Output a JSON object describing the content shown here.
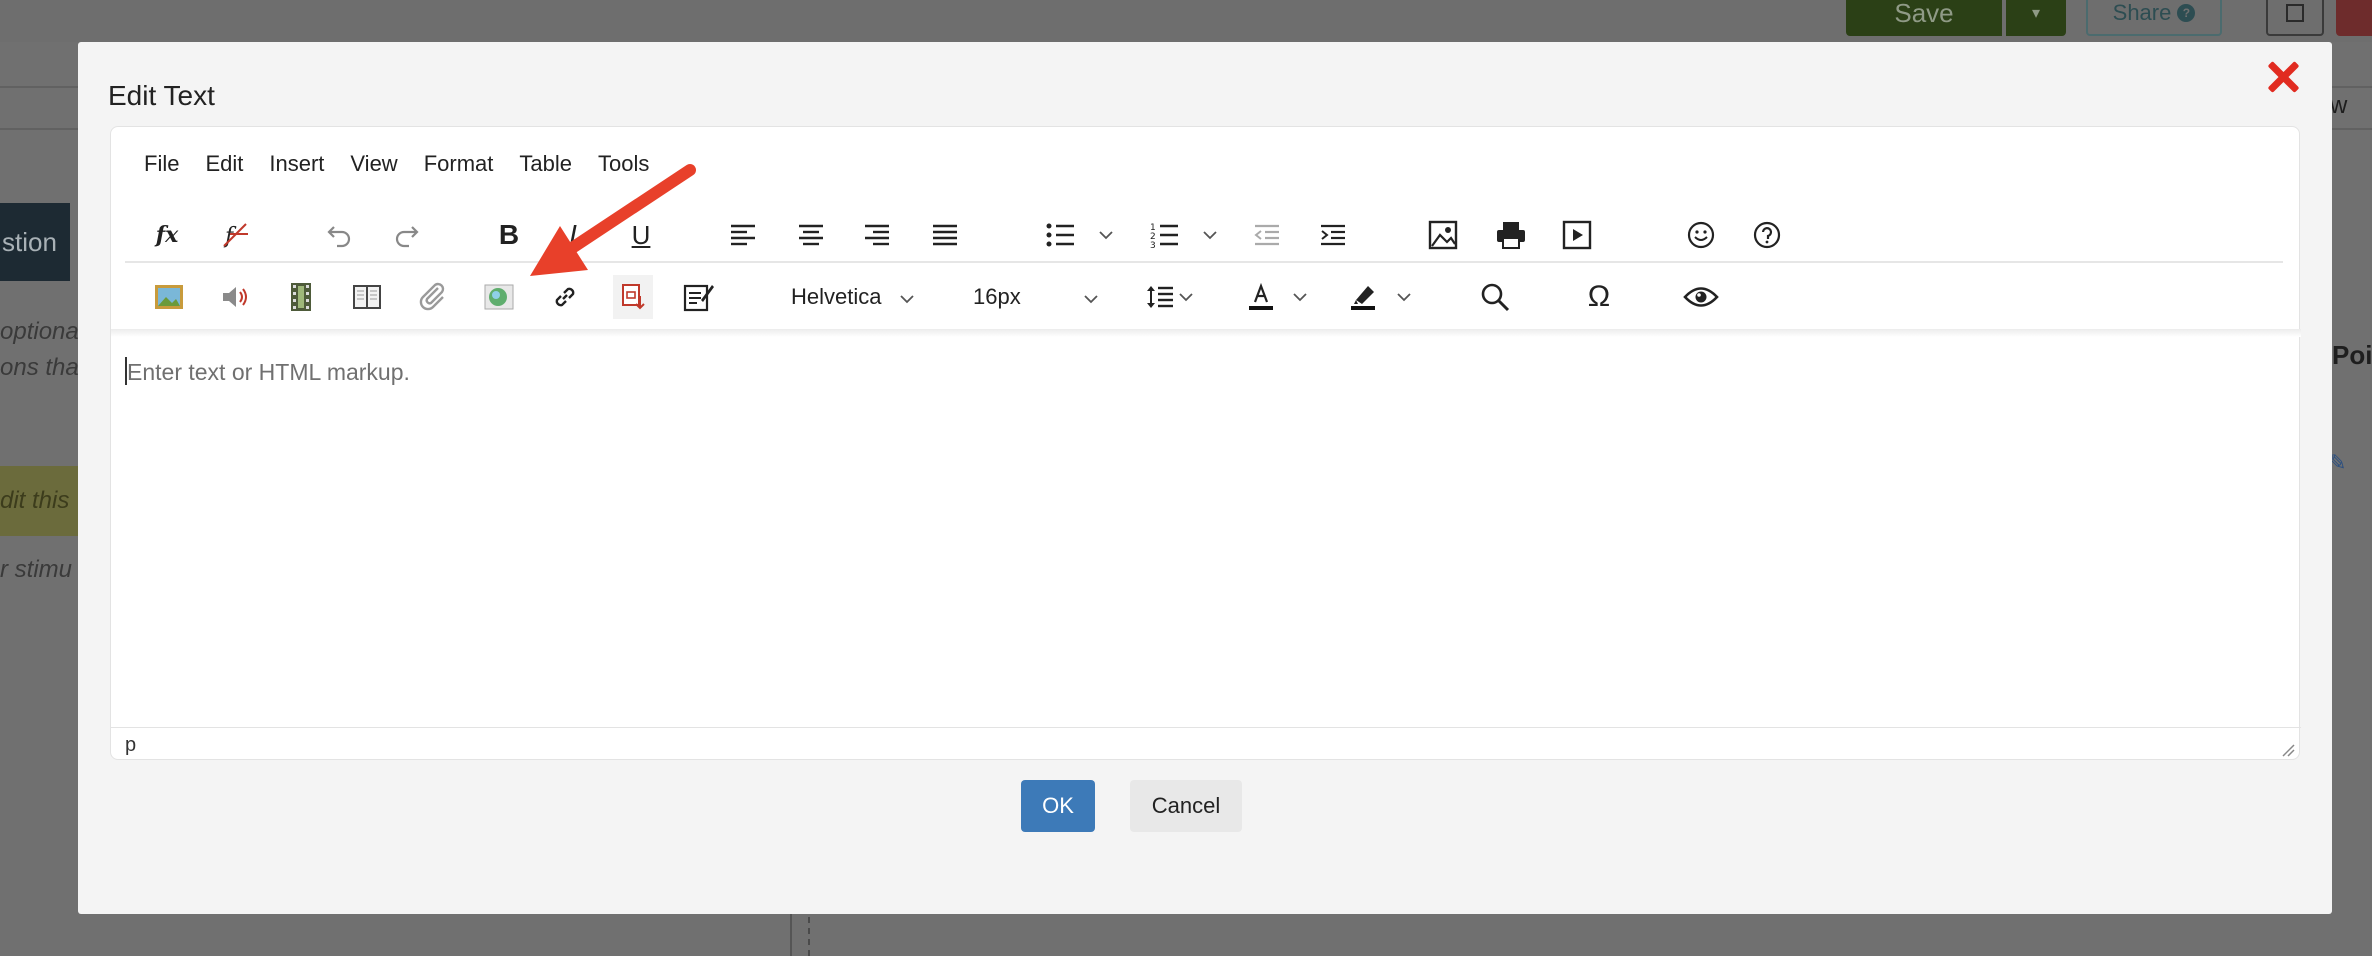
{
  "background": {
    "save_label": "Save",
    "save_caret": "▾",
    "share_label": "Share",
    "share_help": "?",
    "tab_label": "stion",
    "text1": "optiona",
    "text2": "ons tha",
    "yellow_text": "dit this",
    "text3": "r stimu",
    "right_w": "w",
    "right_poi": "Poi",
    "right_pen": "✎"
  },
  "dialog": {
    "title": "Edit Text",
    "close_icon": "close-icon",
    "menu": [
      "File",
      "Edit",
      "Insert",
      "View",
      "Format",
      "Table",
      "Tools"
    ],
    "toolbar_row1_icons": [
      "formula-icon",
      "remove-formatting-icon",
      "undo-icon",
      "redo-icon",
      "bold-icon",
      "italic-icon",
      "underline-icon",
      "align-left-icon",
      "align-center-icon",
      "align-right-icon",
      "justify-icon",
      "bullet-list-icon",
      "numbered-list-icon",
      "outdent-icon",
      "indent-icon",
      "insert-image-icon",
      "print-icon",
      "media-icon",
      "emoticons-icon",
      "help-icon"
    ],
    "toolbar_row1_labels": {
      "bold": "B",
      "italic": "I",
      "underline": "U",
      "formula": "fx"
    },
    "toolbar_row2_icons": [
      "image-gallery-icon",
      "audio-icon",
      "video-icon",
      "book-icon",
      "attachment-icon",
      "web-resource-icon",
      "link-icon",
      "pdf-icon",
      "form-icon",
      "line-height-icon",
      "text-color-icon",
      "highlight-icon",
      "search-icon",
      "special-char-icon",
      "preview-icon"
    ],
    "font_family": "Helvetica",
    "font_size": "16px",
    "special_char": "Ω",
    "placeholder": "Enter text or HTML markup.",
    "status_path": "p",
    "ok_label": "OK",
    "cancel_label": "Cancel",
    "accent_color": "#3d7ab8",
    "arrow_color": "#e8402a"
  }
}
